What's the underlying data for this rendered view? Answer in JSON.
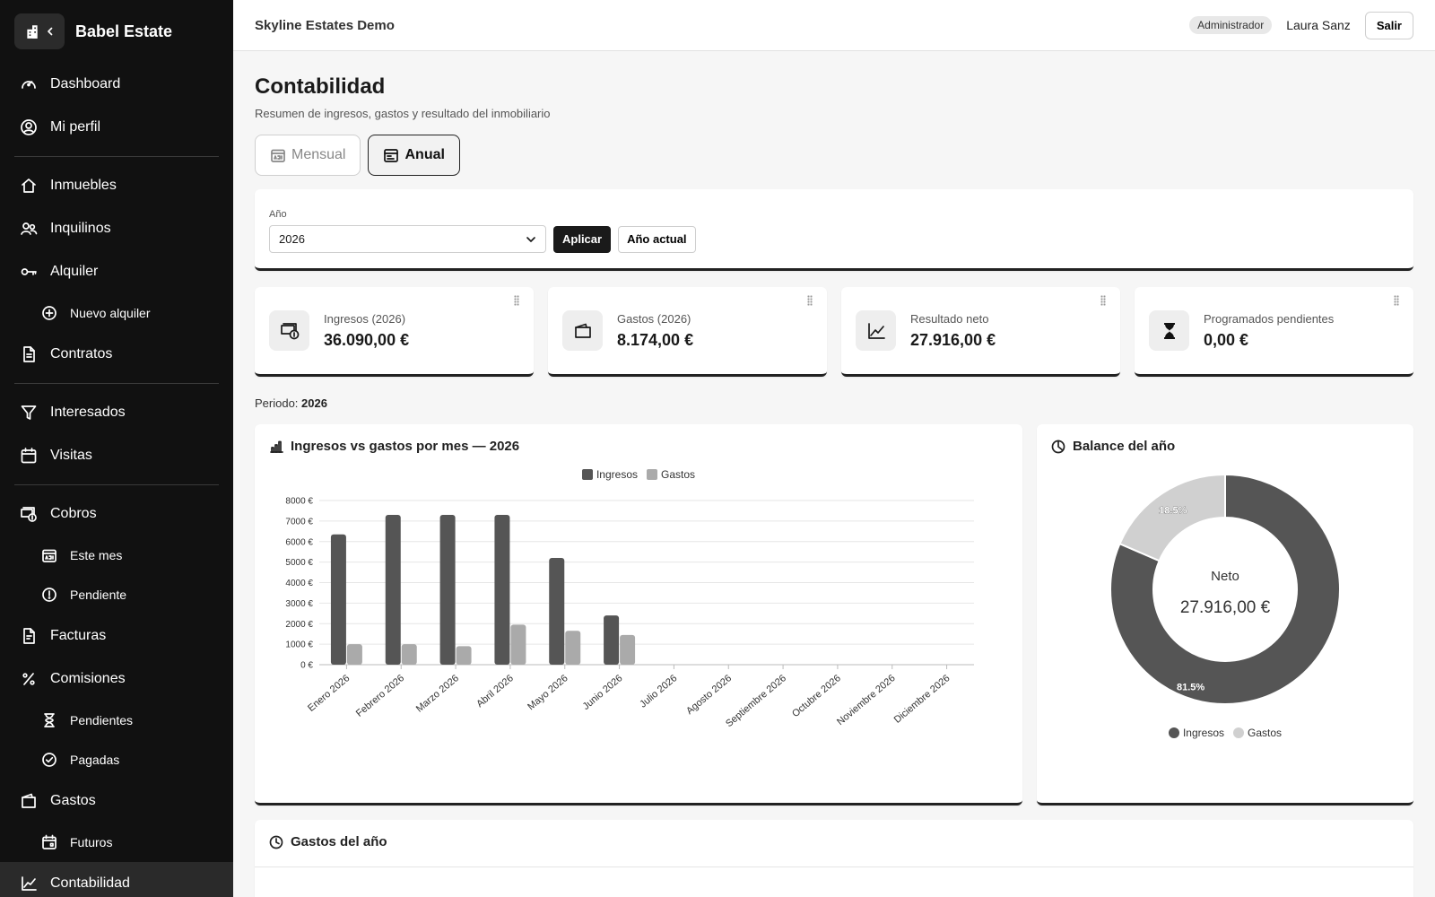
{
  "sidebar": {
    "brand": "Babel Estate",
    "items": [
      {
        "label": "Dashboard",
        "icon": "gauge-icon"
      },
      {
        "label": "Mi perfil",
        "icon": "user-circle-icon"
      },
      {
        "label": "Inmuebles",
        "icon": "house-icon"
      },
      {
        "label": "Inquilinos",
        "icon": "users-icon"
      },
      {
        "label": "Alquiler",
        "icon": "key-icon"
      },
      {
        "label": "Nuevo alquiler",
        "icon": "plus-circle-icon"
      },
      {
        "label": "Contratos",
        "icon": "document-icon"
      },
      {
        "label": "Interesados",
        "icon": "funnel-icon"
      },
      {
        "label": "Visitas",
        "icon": "calendar-icon"
      },
      {
        "label": "Cobros",
        "icon": "cash-stack-icon"
      },
      {
        "label": "Este mes",
        "icon": "calendar-month-icon"
      },
      {
        "label": "Pendiente",
        "icon": "exclamation-circle-icon"
      },
      {
        "label": "Facturas",
        "icon": "invoice-icon"
      },
      {
        "label": "Comisiones",
        "icon": "percent-icon"
      },
      {
        "label": "Pendientes",
        "icon": "hourglass-icon"
      },
      {
        "label": "Pagadas",
        "icon": "check-circle-icon"
      },
      {
        "label": "Gastos",
        "icon": "wallet-icon"
      },
      {
        "label": "Futuros",
        "icon": "calendar-event-icon"
      },
      {
        "label": "Contabilidad",
        "icon": "chart-line-icon"
      }
    ]
  },
  "header": {
    "org": "Skyline Estates Demo",
    "role": "Administrador",
    "user": "Laura Sanz",
    "logout": "Salir"
  },
  "page": {
    "title": "Contabilidad",
    "subtitle": "Resumen de ingresos, gastos y resultado del inmobiliario",
    "toggle": {
      "monthly": "Mensual",
      "annual": "Anual"
    }
  },
  "filter": {
    "label": "Año",
    "value": "2026",
    "apply": "Aplicar",
    "current_year": "Año actual"
  },
  "kpis": [
    {
      "label": "Ingresos (2026)",
      "value": "36.090,00 €",
      "icon": "cash-coin-icon"
    },
    {
      "label": "Gastos (2026)",
      "value": "8.174,00 €",
      "icon": "wallet-icon"
    },
    {
      "label": "Resultado neto",
      "value": "27.916,00 €",
      "icon": "graph-up-icon"
    },
    {
      "label": "Programados pendientes",
      "value": "0,00 €",
      "icon": "hourglass-icon"
    }
  ],
  "period": {
    "label": "Periodo:",
    "value": "2026"
  },
  "colors": {
    "ingresos_bar": "#555555",
    "gastos_bar": "#aaaaaa",
    "ingresos_pie": "#555555",
    "gastos_pie": "#d0d0d0",
    "sidebar_bg": "#111111"
  },
  "chart_data": [
    {
      "type": "bar",
      "title": "Ingresos vs gastos por mes — 2026",
      "categories": [
        "Enero 2026",
        "Febrero 2026",
        "Marzo 2026",
        "Abril 2026",
        "Mayo 2026",
        "Junio 2026",
        "Julio 2026",
        "Agosto 2026",
        "Septiembre 2026",
        "Octubre 2026",
        "Noviembre 2026",
        "Diciembre 2026"
      ],
      "series": [
        {
          "name": "Ingresos",
          "values": [
            6350,
            7300,
            7300,
            7300,
            5200,
            2400,
            0,
            0,
            0,
            0,
            0,
            0
          ]
        },
        {
          "name": "Gastos",
          "values": [
            1000,
            1000,
            900,
            1950,
            1650,
            1450,
            0,
            0,
            0,
            0,
            0,
            0
          ]
        }
      ],
      "yticks": [
        "0 €",
        "1000 €",
        "2000 €",
        "3000 €",
        "4000 €",
        "5000 €",
        "6000 €",
        "7000 €",
        "8000 €"
      ],
      "ylim": [
        0,
        8000
      ],
      "grid": true,
      "legend": "top-center"
    },
    {
      "type": "pie",
      "title": "Balance del año",
      "labels": [
        "Ingresos",
        "Gastos"
      ],
      "values": [
        81.5,
        18.5
      ],
      "data_labels": [
        "81.5%",
        "18.5%"
      ],
      "center_label": "Neto",
      "center_value": "27.916,00 €",
      "legend": "bottom-center"
    }
  ],
  "bottom": {
    "title": "Gastos del año"
  }
}
